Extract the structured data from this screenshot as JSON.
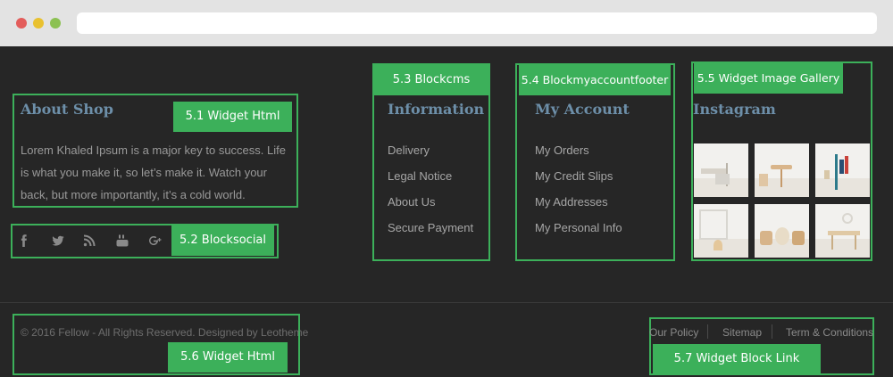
{
  "browser": {},
  "about": {
    "heading": "About Shop",
    "text": "Lorem Khaled Ipsum is a major key to success. Life is what you make it, so let’s make it. Watch your back, but more importantly, it’s a cold world.",
    "tag": "5.1 Widget Html"
  },
  "social": {
    "tag": "5.2 Blocksocial",
    "icons": [
      "facebook-icon",
      "twitter-icon",
      "rss-icon",
      "youtube-icon",
      "google-plus-icon"
    ]
  },
  "information": {
    "tag": "5.3 Blockcms",
    "heading": "Information",
    "links": [
      "Delivery",
      "Legal Notice",
      "About Us",
      "Secure Payment"
    ]
  },
  "account": {
    "tag": "5.4 Blockmyaccountfooter",
    "heading": "My Account",
    "links": [
      "My Orders",
      "My Credit Slips",
      "My Addresses",
      "My Personal Info"
    ]
  },
  "instagram": {
    "tag": "5.5 Widget Image Gallery",
    "heading": "Instagram"
  },
  "bottom": {
    "copyright": "© 2016 Fellow - All Rights Reserved. Designed by Leotheme",
    "copyright_tag": "5.6 Widget Html",
    "links": [
      "Our Policy",
      "Sitemap",
      "Term & Conditions"
    ],
    "links_tag": "5.7 Widget Block Link"
  },
  "colors": {
    "frame_green": "#3cb05a",
    "footer_bg": "#262626",
    "heading_blue": "#6d8fa9"
  }
}
